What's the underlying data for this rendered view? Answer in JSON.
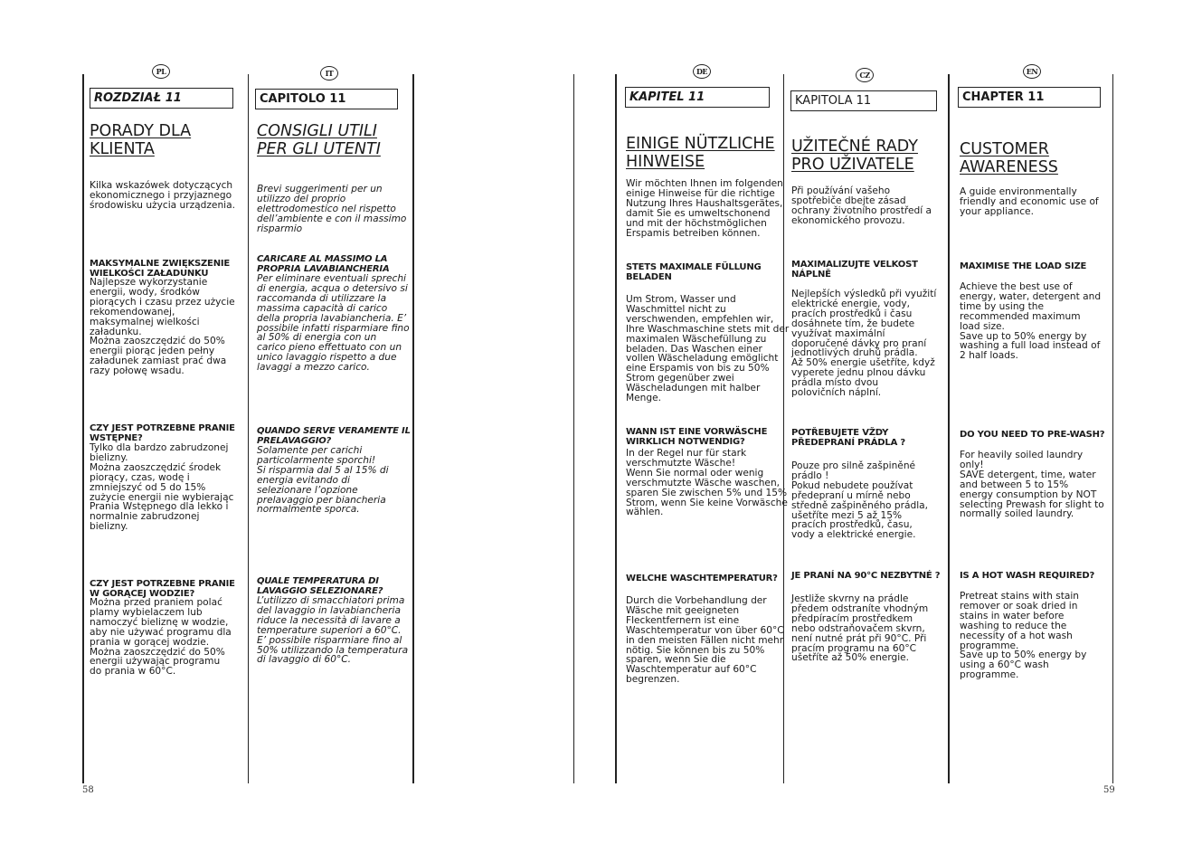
{
  "pages": {
    "left_number": "58",
    "right_number": "59"
  },
  "columns": {
    "pl": {
      "flag": "PL",
      "chapter": "ROZDZIAŁ 11",
      "title": "PORADY DLA\nKLIENTA",
      "intro": "Kilka wskazówek dotyczących\nekonomicznego i przyjaznego\nśrodowisku użycia urządzenia.",
      "sections": [
        {
          "heading": "MAKSYMALNE ZWIĘKSZENIE\nWIELKOŚCI ZAŁADUNKU",
          "text": "Najlepsze wykorzystanie\nenergii, wody, środków\npiorących i czasu przez użycie\nrekomendowanej,\nmaksymalnej wielkości\nzaładunku.\nMożna zaoszczędzić do 50%\nenergii piorąc jeden pełny\nzaładunek zamiast prać dwa\nrazy połowę wsadu."
        },
        {
          "heading": "CZY JEST POTRZEBNE PRANIE\nWSTĘPNE?",
          "text": "Tylko dla bardzo zabrudzonej\nbielizny.\nMożna zaoszczędzić środek\npiorący, czas, wodę i\nzmniejszyć od 5 do 15%\nzużycie energii nie wybierając\nPrania Wstępnego dla lekko i\nnormalnie zabrudzonej\nbielizny."
        },
        {
          "heading": "CZY JEST POTRZEBNE PRANIE\nW GORĄCEJ WODZIE?",
          "text": "Można przed praniem polać\nplamy wybielaczem lub\nnamoczyć bieliznę w wodzie,\naby nie używać programu dla\nprania w gorącej wodzie.\nMożna zaoszczędzić do 50%\nenergii używając programu\ndo prania w 60°C."
        }
      ]
    },
    "it": {
      "flag": "IT",
      "chapter": "CAPITOLO 11",
      "title": "CONSIGLI UTILI\nPER GLI UTENTI",
      "intro": "Brevi suggerimenti per un\nutilizzo del proprio\nelettrodomestico nel rispetto\ndell’ambiente e con il massimo\nrisparmio",
      "sections": [
        {
          "heading": "CARICARE AL MASSIMO LA\nPROPRIA LAVABIANCHERIA",
          "text": "Per eliminare eventuali sprechi\ndi energia, acqua o detersivo si\nraccomanda di utilizzare la\nmassima capacità di carico\ndella propria lavabiancheria. E’\npossibile infatti risparmiare fino\nal 50% di energia con un\ncarico pieno effettuato con un\nunico lavaggio rispetto a due\nlavaggi a mezzo carico."
        },
        {
          "heading": "QUANDO SERVE VERAMENTE IL\nPRELAVAGGIO?",
          "text": "Solamente per carichi\nparticolarmente sporchi!\nSi risparmia dal 5 al 15% di\nenergia evitando di\nselezionare l’opzione\nprelavaggio per biancheria\nnormalmente sporca."
        },
        {
          "heading": "QUALE TEMPERATURA DI\nLAVAGGIO SELEZIONARE?",
          "text": "L’utilizzo di smacchiatori prima\ndel lavaggio in lavabiancheria\nriduce la necessità di lavare a\ntemperature superiori a 60°C.\nE’ possibile risparmiare fino al\n50% utilizzando la temperatura\ndi lavaggio di 60°C."
        }
      ]
    },
    "de": {
      "flag": "DE",
      "chapter": "KAPITEL 11",
      "title": "EINIGE NÜTZLICHE\nHINWEISE",
      "intro": "Wir möchten Ihnen im folgenden\neinige Hinweise für die richtige\nNutzung Ihres Haushaltsgerätes,\ndamit Sie es umweltschonend\nund mit der höchstmöglichen\nErspamis betreiben können.",
      "sections": [
        {
          "heading": "STETS MAXIMALE FÜLLUNG\nBELADEN",
          "text": "Um Strom, Wasser und\nWaschmittel nicht zu\nverschwenden, empfehlen wir,\nIhre Waschmaschine stets mit der\nmaximalen Wäschefüllung zu\nbeladen. Das Waschen einer\nvollen Wäscheladung emöglicht\neine Erspamis von bis zu 50%\nStrom gegenüber zwei\nWäscheladungen mit halber\nMenge."
        },
        {
          "heading": "WANN IST EINE VORWÄSCHE\nWIRKLICH NOTWENDIG?",
          "text": "In der Regel nur für stark\nverschmutzte Wäsche!\nWenn Sie normal oder wenig\nverschmutzte Wäsche waschen,\nsparen Sie zwischen 5% und 15%\nStrom, wenn Sie keine Vorwäsche\nwählen."
        },
        {
          "heading": "WELCHE WASCHTEMPERATUR?",
          "text": "Durch die Vorbehandlung der\nWäsche mit geeigneten\nFleckentfernern ist eine\nWaschtemperatur von über 60°C\nin den meisten Fällen nicht mehr\nnötig. Sie können bis zu 50%\nsparen, wenn Sie die\nWaschtemperatur auf 60°C\nbegrenzen."
        }
      ]
    },
    "cz": {
      "flag": "CZ",
      "chapter": "KAPITOLA 11",
      "title": "UŽITEČNÉ RADY\nPRO UŽIVATELE",
      "intro": "Při používání vašeho\nspotřebiče dbejte zásad\nochrany životního prostředí a\nekonomického provozu.",
      "sections": [
        {
          "heading": "MAXIMALIZUJTE VELKOST\nNÁPLNĚ",
          "text": "Nejlepších výsledků při využití\nelektrické energie, vody,\npracích prostředků i času\ndosáhnete tím, že budete\nvyužívat maximální\ndoporučené dávky pro praní\njednotlivých druhů prádla.\nAž 50% energie ušetříte, když\nvyperete jednu plnou dávku\nprádla místo dvou\npolovičních náplní."
        },
        {
          "heading": "POTŘEBUJETE VŽDY\nPŘEDEPRANÍ PRÁDLA ?",
          "text": "Pouze pro silně zašpiněné\nprádlo !\nPokud nebudete používat\npředepraní u mírně nebo\nstředně zašpiněného prádla,\nušetříte mezi 5 až 15%\npracích prostředků, času,\nvody a elektrické energie."
        },
        {
          "heading": "JE PRANÍ NA 90°C NEZBYTNÉ ?",
          "text": "Jestliže skvrny na prádle\npředem odstraníte vhodným\npředpíracím prostředkem\nnebo odstraňovačem skvrn,\nnení nutné prát při 90°C. Při\npracím programu na 60°C\nušetříte až 50% energie."
        }
      ]
    },
    "en": {
      "flag": "EN",
      "chapter": "CHAPTER 11",
      "title": "CUSTOMER\nAWARENESS",
      "intro": "A guide environmentally\nfriendly and economic use of\nyour appliance.",
      "sections": [
        {
          "heading": "MAXIMISE THE LOAD SIZE",
          "text": "Achieve the best use of\nenergy, water, detergent and\ntime by using the\nrecommended maximum\nload size.\nSave up to 50% energy by\nwashing a full load instead of\n2 half loads."
        },
        {
          "heading": "DO YOU NEED TO PRE-WASH?",
          "text": "For heavily soiled laundry\nonly!\nSAVE detergent, time, water\nand between 5 to 15%\nenergy consumption by NOT\nselecting Prewash for slight to\nnormally soiled laundry."
        },
        {
          "heading": "IS A HOT WASH REQUIRED?",
          "text": "Pretreat stains with stain\nremover or soak dried in\nstains in water before\nwashing to reduce the\nnecessity of a hot wash\nprogramme.\nSave up to 50% energy by\nusing a 60°C wash\nprogramme."
        }
      ]
    }
  }
}
